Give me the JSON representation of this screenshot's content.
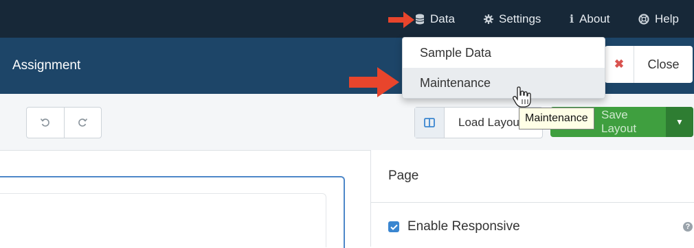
{
  "topnav": {
    "items": [
      {
        "label": "Data",
        "icon": "database-icon"
      },
      {
        "label": "Settings",
        "icon": "gear-icon"
      },
      {
        "label": "About",
        "icon": "info-icon"
      },
      {
        "label": "Help",
        "icon": "lifebuoy-icon"
      }
    ]
  },
  "titlebar": {
    "title": "Assignment",
    "close_label": "Close"
  },
  "toolbar": {
    "load_label": "Load Layout",
    "save_label": "Save Layout"
  },
  "dropdown": {
    "items": [
      {
        "label": "Sample Data"
      },
      {
        "label": "Maintenance"
      }
    ]
  },
  "tooltip": "Maintenance",
  "right_panel": {
    "header": "Page",
    "responsive_label": "Enable Responsive",
    "responsive_checked": true
  },
  "colors": {
    "topnav_bg": "#172838",
    "titlebar_bg": "#1d4568",
    "save_green": "#3f9f3f",
    "callout_arrow": "#e8452c"
  }
}
